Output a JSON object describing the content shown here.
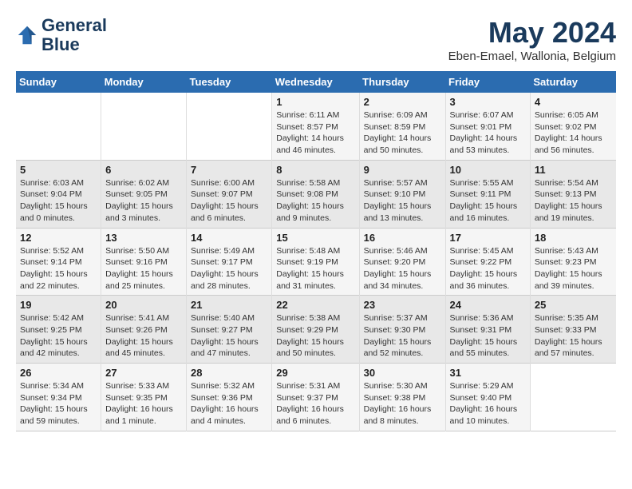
{
  "header": {
    "logo_line1": "General",
    "logo_line2": "Blue",
    "month_title": "May 2024",
    "location": "Eben-Emael, Wallonia, Belgium"
  },
  "weekdays": [
    "Sunday",
    "Monday",
    "Tuesday",
    "Wednesday",
    "Thursday",
    "Friday",
    "Saturday"
  ],
  "weeks": [
    [
      {
        "day": "",
        "info": ""
      },
      {
        "day": "",
        "info": ""
      },
      {
        "day": "",
        "info": ""
      },
      {
        "day": "1",
        "info": "Sunrise: 6:11 AM\nSunset: 8:57 PM\nDaylight: 14 hours\nand 46 minutes."
      },
      {
        "day": "2",
        "info": "Sunrise: 6:09 AM\nSunset: 8:59 PM\nDaylight: 14 hours\nand 50 minutes."
      },
      {
        "day": "3",
        "info": "Sunrise: 6:07 AM\nSunset: 9:01 PM\nDaylight: 14 hours\nand 53 minutes."
      },
      {
        "day": "4",
        "info": "Sunrise: 6:05 AM\nSunset: 9:02 PM\nDaylight: 14 hours\nand 56 minutes."
      }
    ],
    [
      {
        "day": "5",
        "info": "Sunrise: 6:03 AM\nSunset: 9:04 PM\nDaylight: 15 hours\nand 0 minutes."
      },
      {
        "day": "6",
        "info": "Sunrise: 6:02 AM\nSunset: 9:05 PM\nDaylight: 15 hours\nand 3 minutes."
      },
      {
        "day": "7",
        "info": "Sunrise: 6:00 AM\nSunset: 9:07 PM\nDaylight: 15 hours\nand 6 minutes."
      },
      {
        "day": "8",
        "info": "Sunrise: 5:58 AM\nSunset: 9:08 PM\nDaylight: 15 hours\nand 9 minutes."
      },
      {
        "day": "9",
        "info": "Sunrise: 5:57 AM\nSunset: 9:10 PM\nDaylight: 15 hours\nand 13 minutes."
      },
      {
        "day": "10",
        "info": "Sunrise: 5:55 AM\nSunset: 9:11 PM\nDaylight: 15 hours\nand 16 minutes."
      },
      {
        "day": "11",
        "info": "Sunrise: 5:54 AM\nSunset: 9:13 PM\nDaylight: 15 hours\nand 19 minutes."
      }
    ],
    [
      {
        "day": "12",
        "info": "Sunrise: 5:52 AM\nSunset: 9:14 PM\nDaylight: 15 hours\nand 22 minutes."
      },
      {
        "day": "13",
        "info": "Sunrise: 5:50 AM\nSunset: 9:16 PM\nDaylight: 15 hours\nand 25 minutes."
      },
      {
        "day": "14",
        "info": "Sunrise: 5:49 AM\nSunset: 9:17 PM\nDaylight: 15 hours\nand 28 minutes."
      },
      {
        "day": "15",
        "info": "Sunrise: 5:48 AM\nSunset: 9:19 PM\nDaylight: 15 hours\nand 31 minutes."
      },
      {
        "day": "16",
        "info": "Sunrise: 5:46 AM\nSunset: 9:20 PM\nDaylight: 15 hours\nand 34 minutes."
      },
      {
        "day": "17",
        "info": "Sunrise: 5:45 AM\nSunset: 9:22 PM\nDaylight: 15 hours\nand 36 minutes."
      },
      {
        "day": "18",
        "info": "Sunrise: 5:43 AM\nSunset: 9:23 PM\nDaylight: 15 hours\nand 39 minutes."
      }
    ],
    [
      {
        "day": "19",
        "info": "Sunrise: 5:42 AM\nSunset: 9:25 PM\nDaylight: 15 hours\nand 42 minutes."
      },
      {
        "day": "20",
        "info": "Sunrise: 5:41 AM\nSunset: 9:26 PM\nDaylight: 15 hours\nand 45 minutes."
      },
      {
        "day": "21",
        "info": "Sunrise: 5:40 AM\nSunset: 9:27 PM\nDaylight: 15 hours\nand 47 minutes."
      },
      {
        "day": "22",
        "info": "Sunrise: 5:38 AM\nSunset: 9:29 PM\nDaylight: 15 hours\nand 50 minutes."
      },
      {
        "day": "23",
        "info": "Sunrise: 5:37 AM\nSunset: 9:30 PM\nDaylight: 15 hours\nand 52 minutes."
      },
      {
        "day": "24",
        "info": "Sunrise: 5:36 AM\nSunset: 9:31 PM\nDaylight: 15 hours\nand 55 minutes."
      },
      {
        "day": "25",
        "info": "Sunrise: 5:35 AM\nSunset: 9:33 PM\nDaylight: 15 hours\nand 57 minutes."
      }
    ],
    [
      {
        "day": "26",
        "info": "Sunrise: 5:34 AM\nSunset: 9:34 PM\nDaylight: 15 hours\nand 59 minutes."
      },
      {
        "day": "27",
        "info": "Sunrise: 5:33 AM\nSunset: 9:35 PM\nDaylight: 16 hours\nand 1 minute."
      },
      {
        "day": "28",
        "info": "Sunrise: 5:32 AM\nSunset: 9:36 PM\nDaylight: 16 hours\nand 4 minutes."
      },
      {
        "day": "29",
        "info": "Sunrise: 5:31 AM\nSunset: 9:37 PM\nDaylight: 16 hours\nand 6 minutes."
      },
      {
        "day": "30",
        "info": "Sunrise: 5:30 AM\nSunset: 9:38 PM\nDaylight: 16 hours\nand 8 minutes."
      },
      {
        "day": "31",
        "info": "Sunrise: 5:29 AM\nSunset: 9:40 PM\nDaylight: 16 hours\nand 10 minutes."
      },
      {
        "day": "",
        "info": ""
      }
    ]
  ]
}
